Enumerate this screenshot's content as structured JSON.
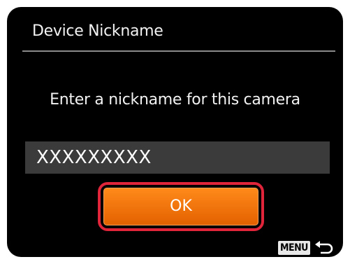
{
  "screen": {
    "title": "Device Nickname",
    "prompt": "Enter a nickname for this camera",
    "nickname_value": "XXXXXXXXX",
    "ok_label": "OK",
    "menu_label": "MENU",
    "back_icon": "return-arrow-icon"
  },
  "colors": {
    "background": "#000000",
    "field": "#3b3b3b",
    "button": "#f07400",
    "highlight": "#e0243a"
  }
}
